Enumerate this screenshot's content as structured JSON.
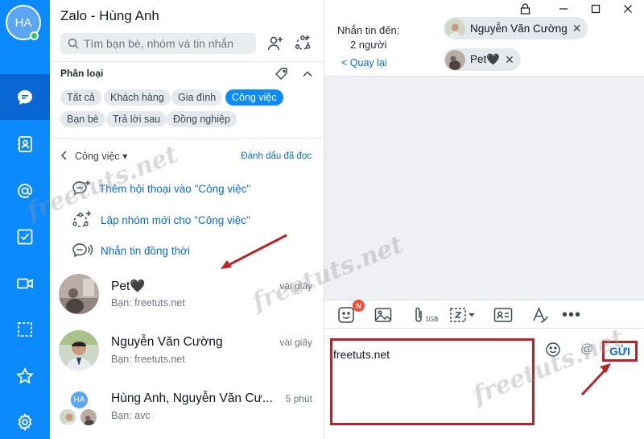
{
  "app": {
    "title": "Zalo - Hùng Anh",
    "user_initials": "HA"
  },
  "search": {
    "placeholder": "Tìm bạn bè, nhóm và tin nhắn"
  },
  "categories": {
    "title": "Phân loại",
    "chips": [
      "Tất cả",
      "Khách hàng",
      "Gia đình",
      "Công việc",
      "Bạn bè",
      "Trả lời sau",
      "Đồng nghiệp"
    ],
    "selected": "Công việc"
  },
  "subfilter": {
    "label": "Công việc",
    "mark_read": "Đánh dấu đã đọc"
  },
  "actions": [
    {
      "label": "Thêm hội thoại vào \"Công việc\"",
      "icon": "chat-add-icon"
    },
    {
      "label": "Lập nhóm mới cho \"Công việc\"",
      "icon": "group-add-icon"
    },
    {
      "label": "Nhắn tin đồng thời",
      "icon": "broadcast-icon"
    }
  ],
  "conversations": [
    {
      "name": "Pet🖤",
      "sub": "Bạn: freetuts.net",
      "time": "vài giây"
    },
    {
      "name": "Nguyễn Văn Cường",
      "sub": "Bạn: freetuts.net",
      "time": "vài giây"
    },
    {
      "name": "Hùng Anh, Nguyễn Văn Cư...",
      "sub": "Bạn: avc",
      "time": "5 phút",
      "group_initials": "HA"
    }
  ],
  "chat": {
    "to_label_line1": "Nhắn tin đến:",
    "to_label_line2": "2 người",
    "back_label": "< Quay lại",
    "recipients": [
      "Nguyễn Văn Cường",
      "Pet🖤"
    ],
    "toolbar": {
      "badge": "N",
      "file_size": "1GB"
    },
    "compose_text": "freetuts.net",
    "send_label": "GỬI"
  },
  "watermark": "freetuts.net",
  "colors": {
    "brand": "#0a8afd",
    "link": "#0a6ad6",
    "annotation": "#b4262b",
    "badge": "#f24d3a",
    "online": "#3bc559"
  }
}
